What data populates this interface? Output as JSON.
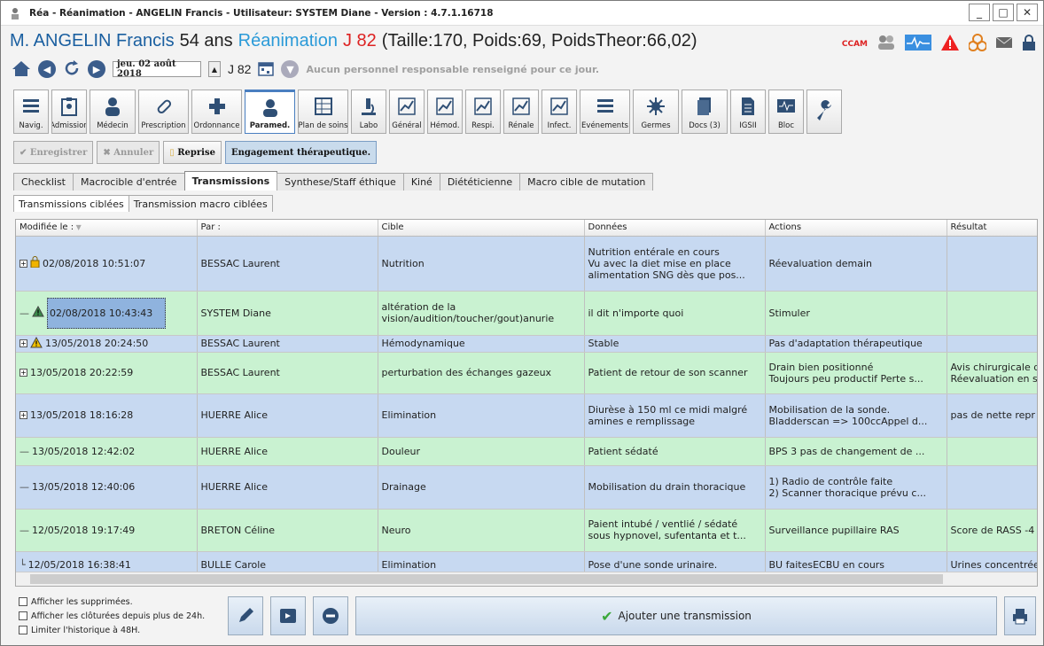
{
  "window": {
    "title": "Réa - Réanimation - ANGELIN Francis - Utilisateur: SYSTEM Diane - Version : 4.7.1.16718",
    "minimize": "_",
    "maximize": "□",
    "close": "✕"
  },
  "patient": {
    "name": "M. ANGELIN Francis",
    "age": "54 ans",
    "service": "Réanimation",
    "day": "J 82",
    "measures": "(Taille:170, Poids:69, PoidsTheor:66,02)",
    "ccam": "CCAM"
  },
  "nav": {
    "date": "jeu. 02 août 2018",
    "day": "J 82",
    "no_responsible": "Aucun personnel responsable renseigné pour ce jour."
  },
  "toolbar": [
    {
      "label": "Navig.",
      "icon": "list-icon"
    },
    {
      "label": "Admission",
      "icon": "clipboard-icon"
    },
    {
      "label": "Médecin",
      "icon": "doctor-icon"
    },
    {
      "label": "Prescription",
      "icon": "pill-icon"
    },
    {
      "label": "Ordonnance",
      "icon": "cross-icon"
    },
    {
      "label": "Paramed.",
      "icon": "nurse-icon"
    },
    {
      "label": "Plan de soins",
      "icon": "grid-icon"
    },
    {
      "label": "Labo",
      "icon": "microscope-icon"
    },
    {
      "label": "Général",
      "icon": "chart-icon"
    },
    {
      "label": "Hémod.",
      "icon": "chart-icon"
    },
    {
      "label": "Respi.",
      "icon": "chart-icon"
    },
    {
      "label": "Rénale",
      "icon": "chart-icon"
    },
    {
      "label": "Infect.",
      "icon": "chart-icon"
    },
    {
      "label": "Evénements",
      "icon": "list-icon"
    },
    {
      "label": "Germes",
      "icon": "germ-icon"
    },
    {
      "label": "Docs (3)",
      "icon": "docs-icon"
    },
    {
      "label": "IGSII",
      "icon": "document-icon"
    },
    {
      "label": "Bloc",
      "icon": "monitor-icon"
    },
    {
      "label": "",
      "icon": "wrench-icon"
    }
  ],
  "actions": {
    "save": "Enregistrer",
    "cancel": "Annuler",
    "reprise": "Reprise",
    "engagement": "Engagement thérapeutique."
  },
  "tabs": [
    "Checklist",
    "Macrocible d'entrée",
    "Transmissions",
    "Synthese/Staff éthique",
    "Kiné",
    "Diététicienne",
    "Macro cible de mutation"
  ],
  "subtabs": [
    "Transmissions ciblées",
    "Transmission macro ciblées"
  ],
  "columns": [
    "Modifiée le :",
    "Par :",
    "Cible",
    "Données",
    "Actions",
    "Résultat"
  ],
  "rows": [
    {
      "date": "02/08/2018 10:51:07",
      "by": "BESSAC Laurent",
      "target": "Nutrition",
      "data": "Nutrition entérale en cours\nVu avec la diet mise en place\nalimentation SNG dès que pos...",
      "actions": "Réevaluation demain",
      "result": "",
      "color": "blue",
      "icon": "lock-icon",
      "expand": true
    },
    {
      "date": "02/08/2018 10:43:43",
      "by": "SYSTEM Diane",
      "target": "altération de la\nvision/audition/toucher/gout)anurie",
      "data": "il dit n'importe quoi",
      "actions": "Stimuler",
      "result": "",
      "color": "green",
      "icon": "warning-icon",
      "expand": false
    },
    {
      "date": "13/05/2018 20:24:50",
      "by": "BESSAC Laurent",
      "target": "Hémodynamique",
      "data": "Stable",
      "actions": "Pas d'adaptation thérapeutique",
      "result": "",
      "color": "blue",
      "icon": "warning-icon",
      "expand": true
    },
    {
      "date": "13/05/2018 20:22:59",
      "by": "BESSAC Laurent",
      "target": "perturbation des échanges gazeux",
      "data": "Patient de retour de son scanner",
      "actions": "Drain bien positionné\nToujours peu productif Perte s...",
      "result": "Avis chirurgicale d\nRéevaluation en s",
      "color": "green",
      "icon": "",
      "expand": true
    },
    {
      "date": "13/05/2018 18:16:28",
      "by": "HUERRE Alice",
      "target": "Elimination",
      "data": "Diurèse à 150 ml ce midi malgré\namines e remplissage",
      "actions": "Mobilisation de la sonde.\nBladderscan => 100ccAppel d...",
      "result": "pas de nette repr",
      "color": "blue",
      "icon": "",
      "expand": true
    },
    {
      "date": "13/05/2018 12:42:02",
      "by": "HUERRE Alice",
      "target": "Douleur",
      "data": "Patient sédaté",
      "actions": "BPS 3 pas de changement de ...",
      "result": "",
      "color": "green",
      "icon": "",
      "expand": false
    },
    {
      "date": "13/05/2018 12:40:06",
      "by": "HUERRE Alice",
      "target": "Drainage",
      "data": "Mobilisation du drain thoracique",
      "actions": "1) Radio de contrôle faite\n2) Scanner thoracique prévu c...",
      "result": "",
      "color": "blue",
      "icon": "",
      "expand": false
    },
    {
      "date": "12/05/2018 19:17:49",
      "by": "BRETON Céline",
      "target": "Neuro",
      "data": "Paient intubé / ventlié / sédaté\nsous hypnovel, sufentanta et t...",
      "actions": "Surveillance pupillaire RAS",
      "result": "Score de RASS -4",
      "color": "green",
      "icon": "",
      "expand": false
    },
    {
      "date": "12/05/2018 16:38:41",
      "by": "BULLE Carole",
      "target": "Elimination",
      "data": "Pose d'une sonde urinaire.",
      "actions": "BU faitesECBU en cours",
      "result": "Urines concentrée",
      "color": "blue",
      "icon": "",
      "expand": false
    }
  ],
  "checkboxes": [
    "Afficher les supprimées.",
    "Afficher les clôturées depuis plus de 24h.",
    "Limiter l'historique à 48H."
  ],
  "add_transmission": "Ajouter une transmission"
}
